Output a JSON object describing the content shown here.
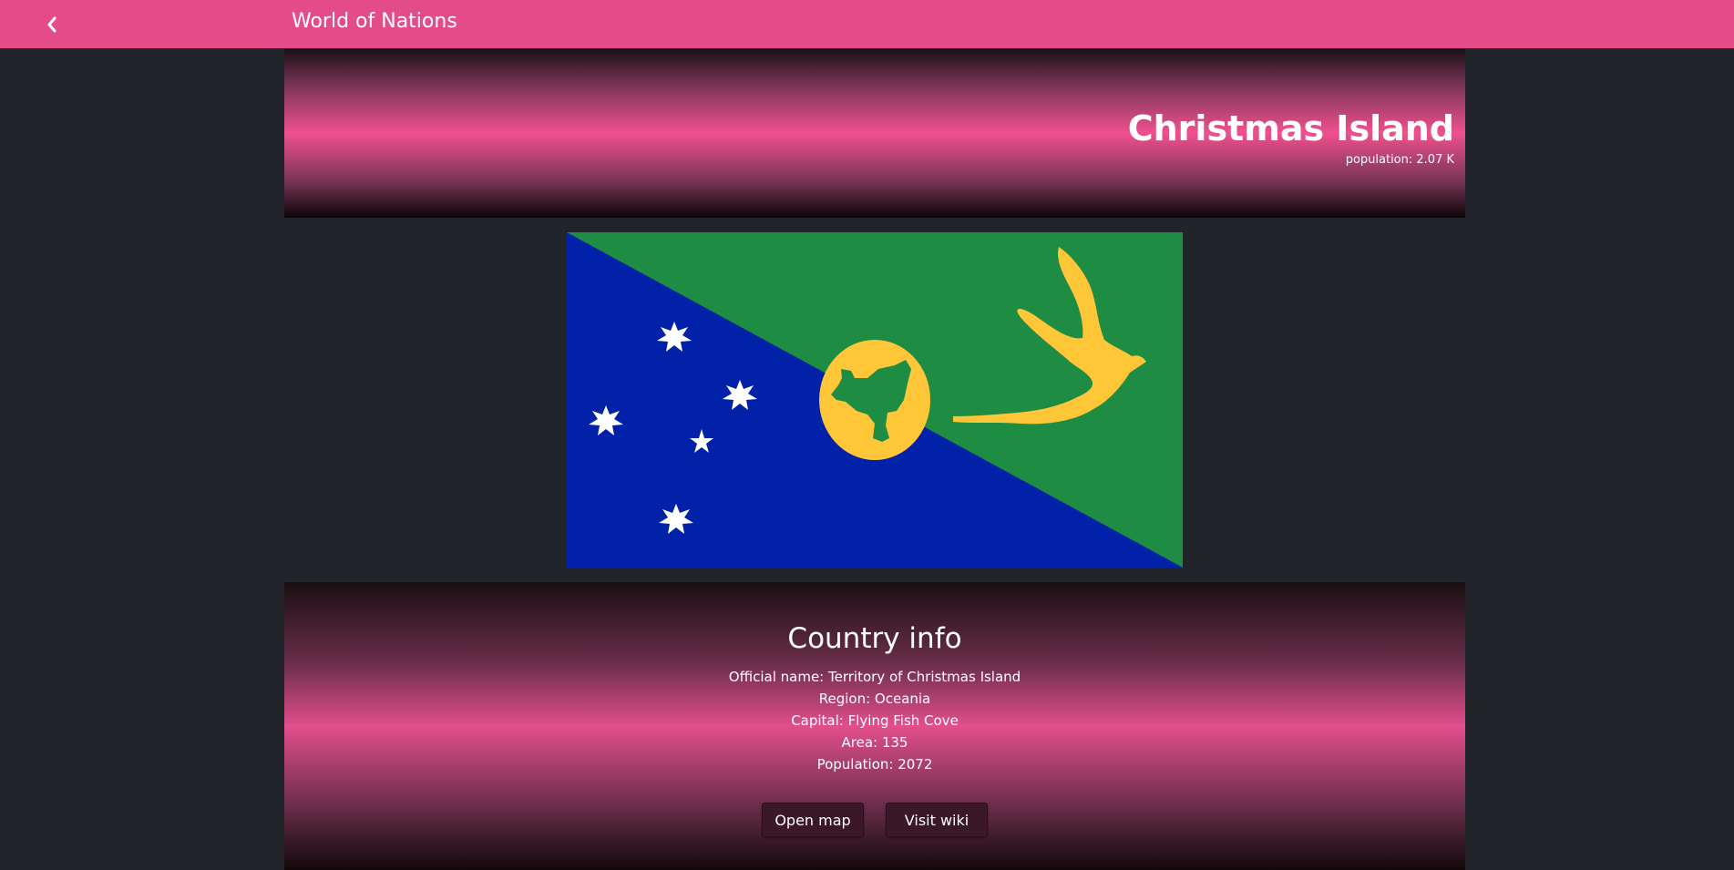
{
  "header": {
    "title": "World of Nations",
    "back_icon": "chevron-left-icon",
    "color": "#e34b89"
  },
  "hero": {
    "name": "Christmas Island",
    "population": "population: 2.07 K"
  },
  "flag": {
    "colors": {
      "green": "#1e8c43",
      "blue": "#0021a8",
      "gold": "#ffc638",
      "white": "#ffffff"
    }
  },
  "country_info": {
    "title": "Country info",
    "lines": [
      "Official name: Territory of Christmas Island",
      "Region: Oceania",
      "Capital: Flying Fish Cove",
      "Area: 135",
      "Population: 2072"
    ],
    "buttons": {
      "map": "Open map",
      "wiki": "Visit wiki"
    }
  }
}
